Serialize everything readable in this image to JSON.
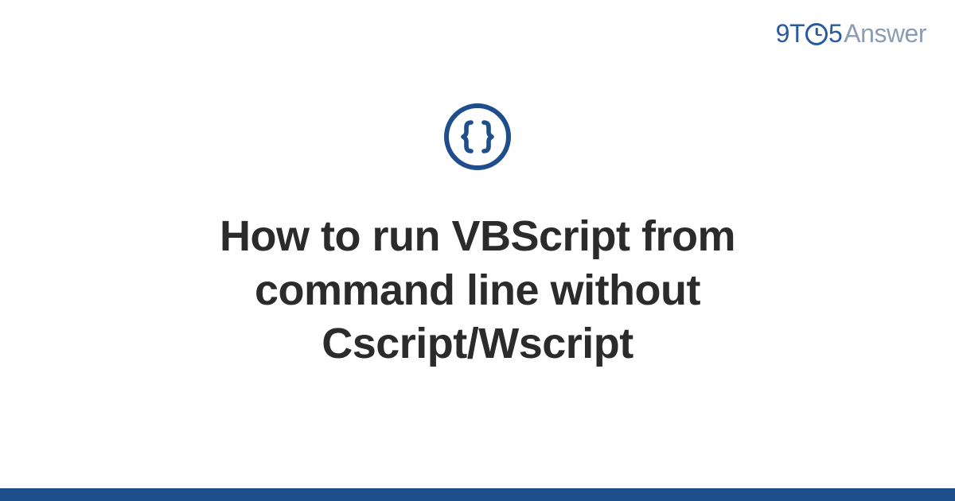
{
  "logo": {
    "part1": "9T",
    "part2": "5",
    "part3": "Answer"
  },
  "icon": {
    "name": "code-braces-icon"
  },
  "title": "How to run VBScript from command line without Cscript/Wscript",
  "colors": {
    "primary": "#1f4e8c",
    "logo_blue": "#2a5a9e",
    "logo_gray": "#8a9db5",
    "text": "#2b2b2b"
  }
}
